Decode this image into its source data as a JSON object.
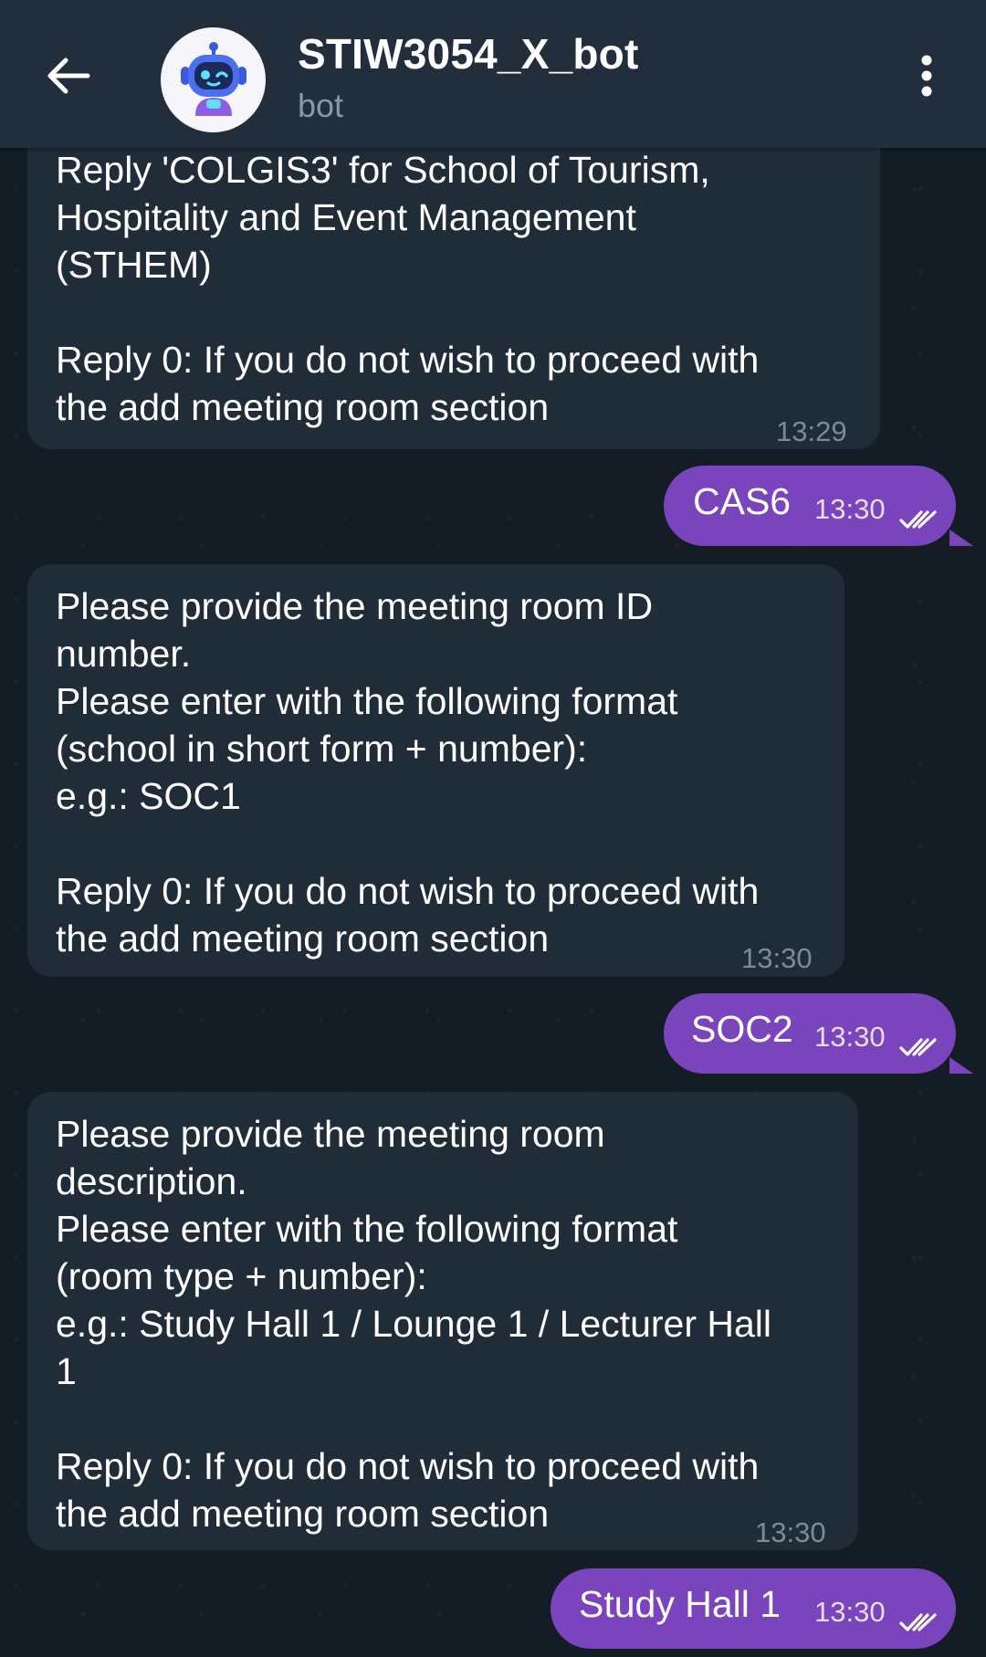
{
  "header": {
    "title": "STIW3054_X_bot",
    "subtitle": "bot"
  },
  "colors": {
    "header_bg": "#232e3c",
    "chat_bg": "#141c26",
    "incoming_bubble": "#212c39",
    "outgoing_bubble": "#7a44bd"
  },
  "messages": [
    {
      "direction": "incoming",
      "text": "Reply 'COLGIS3' for School of Tourism,\nHospitality and Event Management\n(STHEM)\n\nReply 0: If you do not wish to proceed with\nthe add meeting room section",
      "time": "13:29"
    },
    {
      "direction": "outgoing",
      "text": "CAS6",
      "time": "13:30",
      "status": "read"
    },
    {
      "direction": "incoming",
      "text": "Please provide the meeting room ID\nnumber.\nPlease enter with the following format\n(school in short form + number):\ne.g.: SOC1\n\nReply 0: If you do not wish to proceed with\nthe add meeting room section",
      "time": "13:30"
    },
    {
      "direction": "outgoing",
      "text": "SOC2",
      "time": "13:30",
      "status": "read"
    },
    {
      "direction": "incoming",
      "text": "Please provide the meeting room\ndescription.\nPlease enter with the following format\n(room type + number):\ne.g.: Study Hall 1 / Lounge 1 / Lecturer Hall\n1\n\nReply 0: If you do not wish to proceed with\nthe add meeting room section",
      "time": "13:30"
    },
    {
      "direction": "outgoing",
      "text": "Study Hall 1",
      "time": "13:30",
      "status": "read"
    }
  ]
}
